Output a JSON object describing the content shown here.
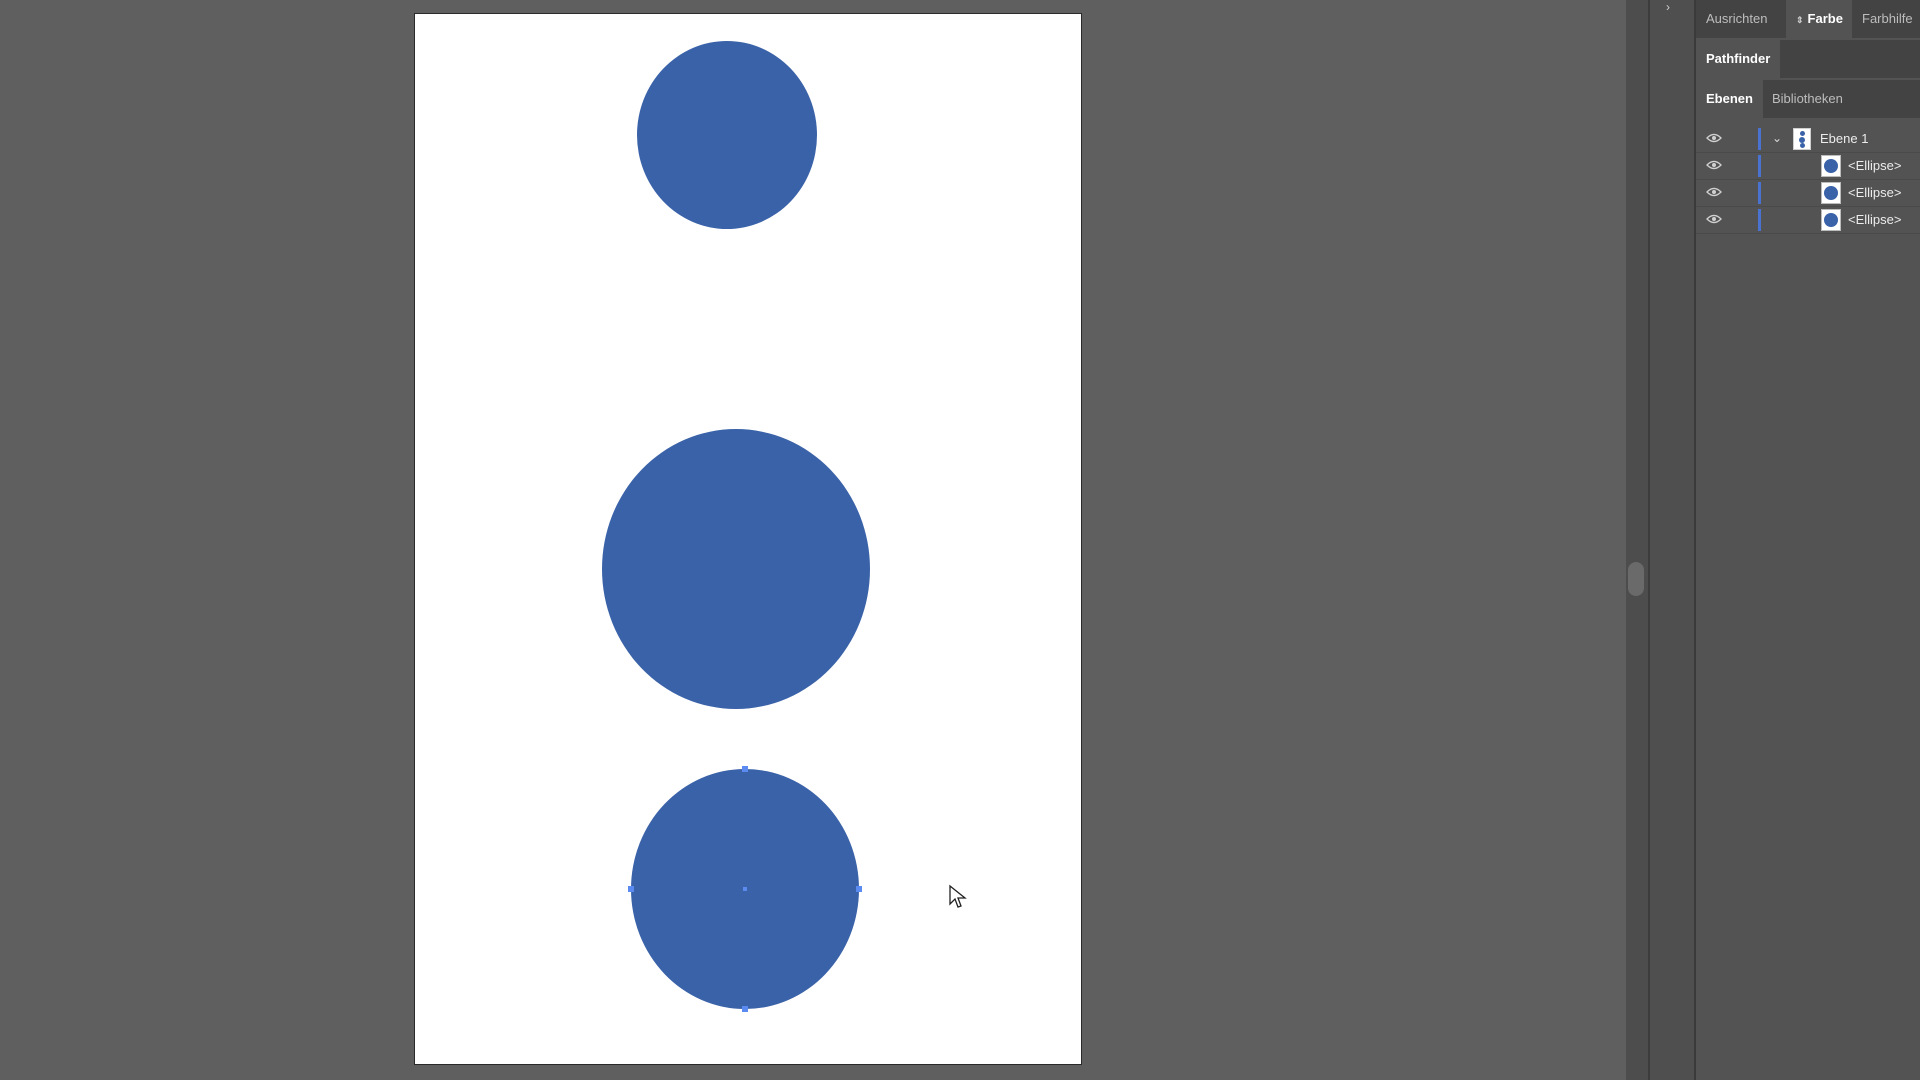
{
  "panel": {
    "top_tabs": [
      {
        "label": "Ausrichten",
        "active": false
      },
      {
        "label": "Farbe",
        "active": true
      },
      {
        "label": "Farbhilfe",
        "active": false
      }
    ],
    "pathfinder_tab": {
      "label": "Pathfinder"
    },
    "layer_tabs": [
      {
        "label": "Ebenen",
        "active": true
      },
      {
        "label": "Bibliotheken",
        "active": false
      }
    ],
    "layers": {
      "parent": {
        "label": "Ebene 1",
        "icon": "chevron-down-icon"
      },
      "children": [
        {
          "label": "<Ellipse>"
        },
        {
          "label": "<Ellipse>"
        },
        {
          "label": "<Ellipse>"
        }
      ]
    }
  },
  "colors": {
    "ellipse_fill": "#3a62a8",
    "layer_color": "#4a72d0",
    "selection_handle": "#5b8bf0",
    "workspace_bg": "#5f5f5f",
    "artboard_bg": "#ffffff"
  }
}
